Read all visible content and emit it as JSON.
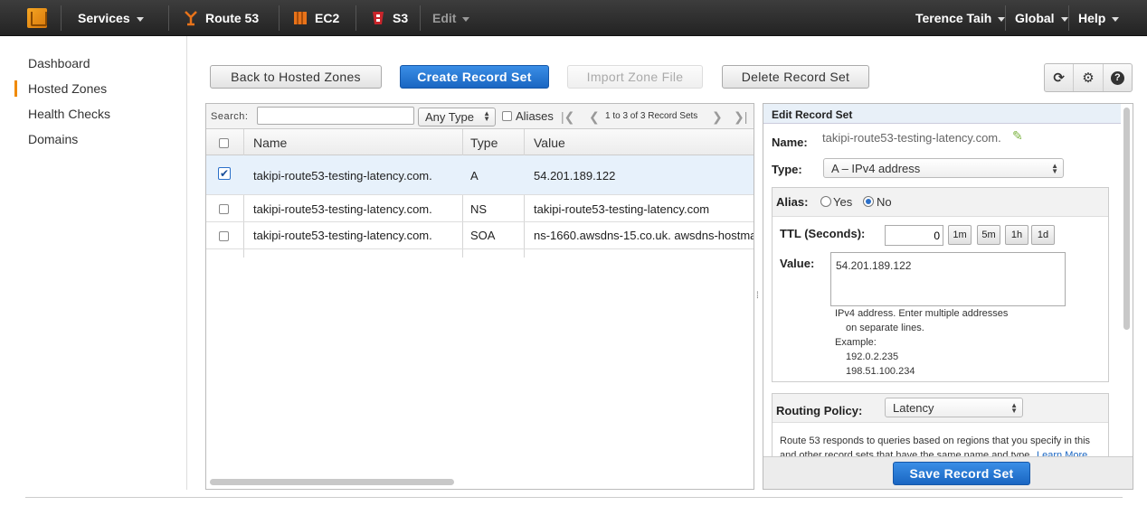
{
  "topnav": {
    "services": "Services",
    "route53": "Route 53",
    "ec2": "EC2",
    "s3": "S3",
    "edit": "Edit",
    "user": "Terence Taih",
    "region": "Global",
    "help": "Help"
  },
  "sidebar": {
    "items": [
      {
        "label": "Dashboard"
      },
      {
        "label": "Hosted Zones"
      },
      {
        "label": "Health Checks"
      },
      {
        "label": "Domains"
      }
    ],
    "active": "Hosted Zones"
  },
  "toolbar": {
    "back": "Back to Hosted Zones",
    "create": "Create Record Set",
    "import": "Import Zone File",
    "delete": "Delete Record Set"
  },
  "grid": {
    "search_label": "Search:",
    "search_value": "",
    "type_filter": "Any Type",
    "aliases_label": "Aliases",
    "pager": "1 to 3 of 3 Record Sets",
    "columns": [
      "Name",
      "Type",
      "Value"
    ],
    "rows": [
      {
        "name": "takipi-route53-testing-latency.com.",
        "type": "A",
        "value": "54.201.189.122",
        "checked": true
      },
      {
        "name": "takipi-route53-testing-latency.com.",
        "type": "NS",
        "value": "takipi-route53-testing-latency.com",
        "checked": false
      },
      {
        "name": "takipi-route53-testing-latency.com.",
        "type": "SOA",
        "value": "ns-1660.awsdns-15.co.uk. awsdns-hostma",
        "checked": false
      }
    ]
  },
  "edit": {
    "header": "Edit Record Set",
    "name_label": "Name:",
    "name_value": "takipi-route53-testing-latency.com.",
    "type_label": "Type:",
    "type_value": "A – IPv4 address",
    "alias_label": "Alias:",
    "alias_yes": "Yes",
    "alias_no": "No",
    "alias_selected": "No",
    "ttl_label": "TTL (Seconds):",
    "ttl_value": "0",
    "ttl_buttons": [
      "1m",
      "5m",
      "1h",
      "1d"
    ],
    "value_label": "Value:",
    "value_text": "54.201.189.122",
    "help_lines": [
      "IPv4 address. Enter multiple addresses",
      "on separate lines.",
      "Example:",
      "192.0.2.235",
      "198.51.100.234"
    ],
    "routing_label": "Routing Policy:",
    "routing_value": "Latency",
    "routing_help_1": "Route 53 responds to queries based on regions that you specify in this",
    "routing_help_2": "and other record sets that have the same name and type.",
    "learn_more": "Learn More",
    "save": "Save Record Set"
  },
  "colors": {
    "primary": "#1a66c2",
    "topbar": "#2b2b2b",
    "accent": "#f08a00",
    "selected_row": "#e7f1fb"
  }
}
